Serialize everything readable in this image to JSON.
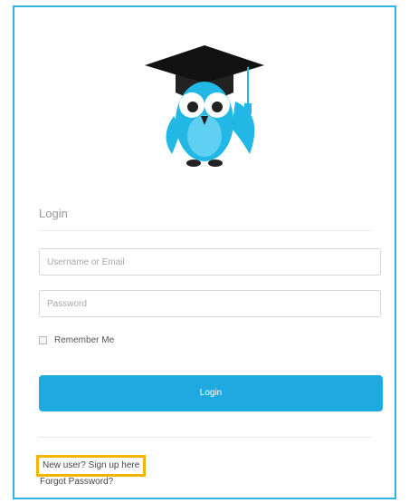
{
  "login": {
    "section_title": "Login",
    "username_placeholder": "Username or Email",
    "password_placeholder": "Password",
    "remember_label": "Remember Me",
    "submit_label": "Login"
  },
  "links": {
    "signup": "New user? Sign up here",
    "forgot": "Forgot Password?"
  },
  "colors": {
    "accent": "#1eaade",
    "border": "#2fb4e6",
    "highlight": "#f4b400"
  },
  "icons": {
    "logo": "graduation-owl-icon"
  }
}
